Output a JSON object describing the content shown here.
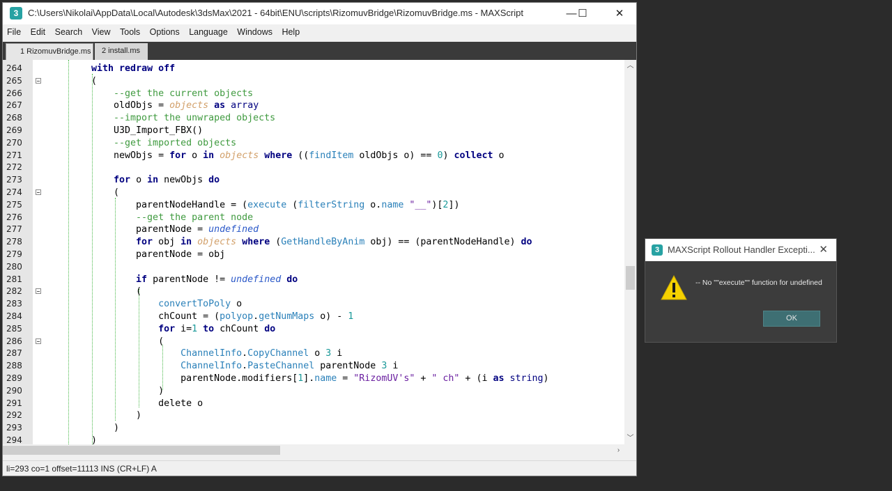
{
  "window": {
    "title": "C:\\Users\\Nikolai\\AppData\\Local\\Autodesk\\3dsMax\\2021 - 64bit\\ENU\\scripts\\RizomuvBridge\\RizomuvBridge.ms - MAXScript",
    "icon": "3",
    "controls": {
      "minimize": "—",
      "maximize": "☐",
      "close": "✕"
    }
  },
  "menu": [
    "File",
    "Edit",
    "Search",
    "View",
    "Tools",
    "Options",
    "Language",
    "Windows",
    "Help"
  ],
  "tabs": [
    {
      "label": "1 RizomuvBridge.ms",
      "active": true
    },
    {
      "label": "2 install.ms",
      "active": false
    }
  ],
  "editor": {
    "lines": [
      {
        "num": "264",
        "text": "        with redraw off"
      },
      {
        "num": "265",
        "text": "        ("
      },
      {
        "num": "266",
        "text": "            --get the current objects"
      },
      {
        "num": "267",
        "text": "            oldObjs = objects as array"
      },
      {
        "num": "268",
        "text": "            --import the unwraped objects"
      },
      {
        "num": "269",
        "text": "            U3D_Import_FBX()"
      },
      {
        "num": "270",
        "text": "            --get imported objects"
      },
      {
        "num": "271",
        "text": "            newObjs = for o in objects where ((findItem oldObjs o) == 0) collect o"
      },
      {
        "num": "272",
        "text": ""
      },
      {
        "num": "273",
        "text": "            for o in newObjs do"
      },
      {
        "num": "274",
        "text": "            ("
      },
      {
        "num": "275",
        "text": "                parentNodeHandle = (execute (filterString o.name \"__\")[2])"
      },
      {
        "num": "276",
        "text": "                --get the parent node"
      },
      {
        "num": "277",
        "text": "                parentNode = undefined"
      },
      {
        "num": "278",
        "text": "                for obj in objects where (GetHandleByAnim obj) == (parentNodeHandle) do"
      },
      {
        "num": "279",
        "text": "                parentNode = obj"
      },
      {
        "num": "280",
        "text": ""
      },
      {
        "num": "281",
        "text": "                if parentNode != undefined do"
      },
      {
        "num": "282",
        "text": "                ("
      },
      {
        "num": "283",
        "text": "                    convertToPoly o"
      },
      {
        "num": "284",
        "text": "                    chCount = (polyop.getNumMaps o) - 1"
      },
      {
        "num": "285",
        "text": "                    for i=1 to chCount do"
      },
      {
        "num": "286",
        "text": "                    ("
      },
      {
        "num": "287",
        "text": "                        ChannelInfo.CopyChannel o 3 i"
      },
      {
        "num": "288",
        "text": "                        ChannelInfo.PasteChannel parentNode 3 i"
      },
      {
        "num": "289",
        "text": "                        parentNode.modifiers[1].name = \"RizomUV's\" + \" ch\" + (i as string)"
      },
      {
        "num": "290",
        "text": "                    )"
      },
      {
        "num": "291",
        "text": "                    delete o"
      },
      {
        "num": "292",
        "text": "                )"
      },
      {
        "num": "293",
        "text": "            )"
      },
      {
        "num": "294",
        "text": "        )"
      }
    ]
  },
  "statusbar": {
    "text": "li=293 co=1 offset=11113 INS (CR+LF) A"
  },
  "dialog": {
    "icon": "3",
    "title": "MAXScript Rollout Handler Excepti...",
    "close": "✕",
    "message": "-- No \"\"execute\"\" function for undefined",
    "ok_label": "OK",
    "warning_icon": "warning-triangle"
  },
  "colors": {
    "keyword": "#000080",
    "comment": "#3f9a3f",
    "objects": "#d2a06a",
    "function": "#2a80b9",
    "number": "#1a9999",
    "string": "#6a1fa0",
    "undefined": "#2a58c8",
    "dialog_bg": "#3c3c3c",
    "ok_button": "#3e6f73"
  }
}
